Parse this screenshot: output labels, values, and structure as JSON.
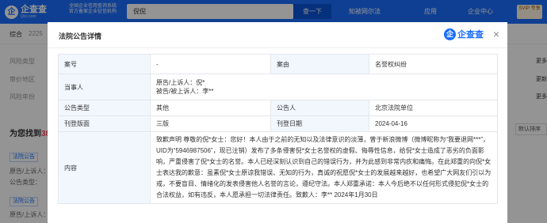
{
  "header": {
    "logo_mark": "企",
    "logo_text": "企查查",
    "logo_sub": "Qcc.com",
    "certification": "全国企业信用查询系统 官方备案企业征信机构",
    "search_value": "倪倪",
    "search_button": "查一下",
    "nav": [
      "知被网尔法",
      "应用",
      "企业中心"
    ],
    "svip": "SVIP 专享"
  },
  "subnav": {
    "tabs": [
      "综合",
      "2225",
      "企",
      "人",
      "法律",
      "招投标",
      "工商"
    ]
  },
  "background": {
    "filters": [
      "风险类型",
      "审价地区",
      "风险年份"
    ],
    "found_prefix": "为您找到",
    "found_count": "385",
    "sort_label": "默认排序",
    "rows": [
      "法院公告",
      "原告/上诉人：",
      "公告类型：",
      "法院公告",
      "原告/上诉人："
    ],
    "right_tags": [
      "更多",
      "更新",
      "更多"
    ]
  },
  "modal": {
    "title": "法院公告详情",
    "brand_mark": "企",
    "brand_text": "企查查",
    "close": "×",
    "rows": {
      "case_no_label": "案号",
      "case_no_value": "-",
      "cause_label": "案由",
      "cause_value": "名誉权纠纷",
      "party_label": "当事人",
      "party_line1": "原告/上诉人：倪*",
      "party_line2": "被告/被上诉人：李**",
      "type_label": "公告类型",
      "type_value": "其他",
      "announcer_label": "公告人",
      "announcer_value": "北京法院单位",
      "page_label": "刊登版面",
      "page_value": "三版",
      "date_label": "刊登日期",
      "date_value": "2024-04-16",
      "content_label": "内容",
      "content_value": "致歉声明 尊敬的倪*女士：您好！本人由于之前的无知以及法律意识的淡薄，曾于新浪微博（微博昵称为“我要退网***”，UID为“5946987506”，现已注销）发布了多条侵害倪*女士名誉权的虚假、侮辱性信息，给倪*女士造成了恶劣的负面影响，严重侵害了倪*女士的名誉。本人已经深刻认识到自己的错误行为，并为此感到非常内疚和痛悔。在此郑重的向倪*女士表达我的歉意：虽素倪*女士原谅我错误、无知的行为，真诚的祝愿倪*女士的发展越来越好，也希望广大网友们引以为戒，不要盲目、情绪化的发表侵害他人名誉的言论，遵纪守法。本人郑重承诺：本人今后绝不以任何形式侵犯倪*女士的合法权益，如有违反，本人愿承担一切法律责任。致歉人：李** 2024年1月30日"
    }
  }
}
